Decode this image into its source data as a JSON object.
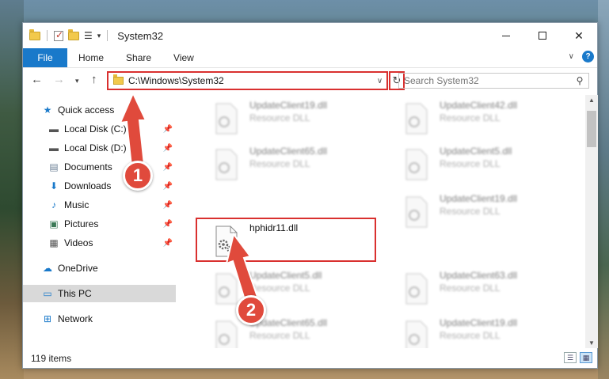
{
  "window": {
    "title": "System32"
  },
  "ribbon": {
    "tabs": [
      "File",
      "Home",
      "Share",
      "View"
    ]
  },
  "address": {
    "path": "C:\\Windows\\System32",
    "search_placeholder": "Search System32"
  },
  "nav": {
    "items": [
      {
        "label": "Quick access",
        "icon": "star-icon",
        "pinned": false
      },
      {
        "label": "Local Disk (C:)",
        "icon": "drive-icon",
        "pinned": true
      },
      {
        "label": "Local Disk (D:)",
        "icon": "drive-icon",
        "pinned": true
      },
      {
        "label": "Documents",
        "icon": "documents-icon",
        "pinned": true
      },
      {
        "label": "Downloads",
        "icon": "download-icon",
        "pinned": true
      },
      {
        "label": "Music",
        "icon": "music-icon",
        "pinned": true
      },
      {
        "label": "Pictures",
        "icon": "pictures-icon",
        "pinned": true
      },
      {
        "label": "Videos",
        "icon": "videos-icon",
        "pinned": true
      },
      {
        "label": "OneDrive",
        "icon": "cloud-icon",
        "pinned": false
      },
      {
        "label": "This PC",
        "icon": "computer-icon",
        "pinned": false,
        "selected": true
      },
      {
        "label": "Network",
        "icon": "network-icon",
        "pinned": false
      }
    ]
  },
  "files": {
    "selected": {
      "name": "hphidr11.dll"
    },
    "blurred": [
      {
        "name": "UpdateClient19.dll",
        "type": "Resource DLL"
      },
      {
        "name": "UpdateClient42.dll",
        "type": "Resource DLL"
      },
      {
        "name": "UpdateClient65.dll",
        "type": "Resource DLL"
      },
      {
        "name": "UpdateClient5.dll",
        "type": "Resource DLL"
      },
      {
        "name": "UpdateClient19.dll",
        "type": "Resource DLL"
      },
      {
        "name": "UpdateClient5.dll",
        "type": "Resource DLL"
      },
      {
        "name": "UpdateClient63.dll",
        "type": "Resource DLL"
      },
      {
        "name": "UpdateClient65.dll",
        "type": "Resource DLL"
      },
      {
        "name": "UpdateClient19.dll",
        "type": "Resource DLL"
      }
    ]
  },
  "status": {
    "count": "119 items"
  },
  "annotations": {
    "marker1": "1",
    "marker2": "2",
    "color": "#e04a3c"
  }
}
